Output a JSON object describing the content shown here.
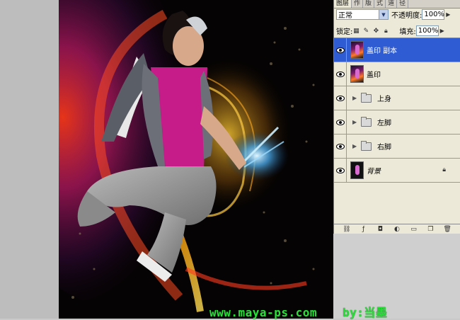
{
  "panel": {
    "tabs": [
      "图层",
      "作",
      "版",
      "式",
      "道",
      "径"
    ],
    "blend_mode": "正常",
    "opacity_label": "不透明度:",
    "opacity_value": "100%",
    "lock_label": "锁定:",
    "fill_label": "填充:",
    "fill_value": "100%"
  },
  "layers": [
    {
      "name": "盖印 副本",
      "type": "raster",
      "selected": true
    },
    {
      "name": "盖印",
      "type": "raster",
      "selected": false
    },
    {
      "name": "上身",
      "type": "group",
      "selected": false
    },
    {
      "name": "左脚",
      "type": "group",
      "selected": false
    },
    {
      "name": "右脚",
      "type": "group",
      "selected": false
    },
    {
      "name": "背景",
      "type": "background",
      "selected": false
    }
  ],
  "watermark": {
    "site": "www.maya-ps.com",
    "author": "by:当墨"
  },
  "colors": {
    "selection": "#2f5cd3",
    "watermark": "#28e038",
    "panel_bg": "#ece9d8"
  }
}
